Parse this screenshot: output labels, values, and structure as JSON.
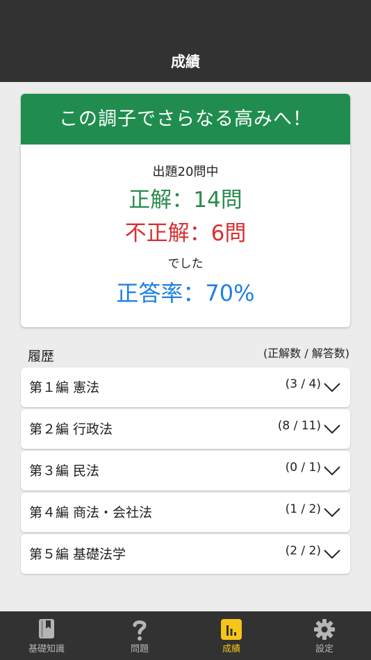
{
  "header": {
    "title": "成績"
  },
  "result": {
    "banner": "この調子でさらなる高みへ！",
    "questions": "出題20問中",
    "correct": "正解：14問",
    "incorrect": "不正解：6問",
    "was": "でした",
    "rate": "正答率：70%"
  },
  "history": {
    "title": "履歴",
    "legend": "(正解数 / 解答数)",
    "rows": [
      {
        "label": "第１編 憲法",
        "count": "(3 / 4)"
      },
      {
        "label": "第２編 行政法",
        "count": "(8 / 11)"
      },
      {
        "label": "第３編 民法",
        "count": "(0 / 1)"
      },
      {
        "label": "第４編 商法・会社法",
        "count": "(1 / 2)"
      },
      {
        "label": "第５編 基礎法学",
        "count": "(2 / 2)"
      }
    ]
  },
  "tabbar": {
    "tabs": [
      {
        "label": "基礎知識",
        "icon": "book-icon"
      },
      {
        "label": "問題",
        "icon": "question-icon"
      },
      {
        "label": "成績",
        "icon": "chart-icon"
      },
      {
        "label": "設定",
        "icon": "gear-icon"
      }
    ],
    "active_tab": "成績"
  },
  "colors": {
    "header": "#323232",
    "banner": "#208d4f",
    "correct": "#2a8a4d",
    "incorrect": "#d92f2f",
    "rate": "#2080e0",
    "active_tab": "#f5c518",
    "inactive_tab": "#b5b5b5"
  }
}
